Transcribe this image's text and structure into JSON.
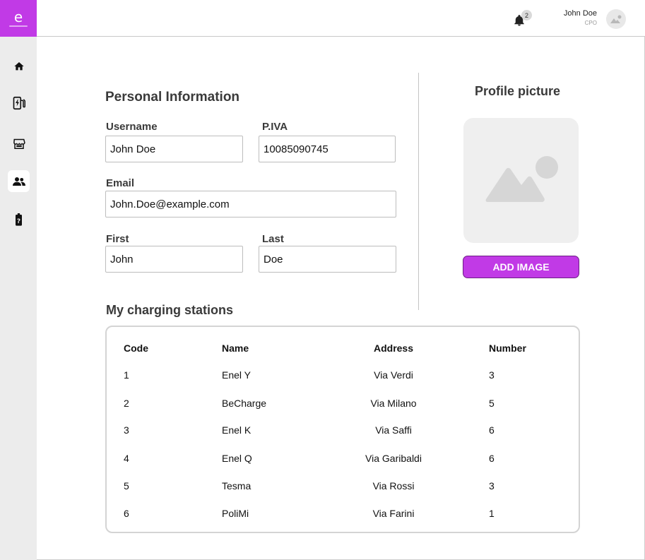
{
  "app": {
    "logo_glyph": "e",
    "brand_color": "#c13ae6"
  },
  "header": {
    "notification_count": "2",
    "user_name": "John Doe",
    "user_role": "CPO",
    "icons": [
      "bell-icon",
      "avatar-image-icon"
    ]
  },
  "sidebar": {
    "items": [
      {
        "name": "home",
        "icon": "home-icon",
        "active": false
      },
      {
        "name": "charging-station",
        "icon": "ev-charger-icon",
        "active": false
      },
      {
        "name": "store",
        "icon": "store-icon",
        "active": false
      },
      {
        "name": "users",
        "icon": "users-icon",
        "active": true
      },
      {
        "name": "battery-help",
        "icon": "battery-question-icon",
        "active": false
      }
    ]
  },
  "personal": {
    "title": "Personal Information",
    "username_label": "Username",
    "username_value": "John Doe",
    "piva_label": "P.IVA",
    "piva_value": "10085090745",
    "email_label": "Email",
    "email_value": "John.Doe@example.com",
    "first_label": "First",
    "first_value": "John",
    "last_label": "Last",
    "last_value": "Doe"
  },
  "profile": {
    "title": "Profile picture",
    "placeholder_icon": "image-placeholder-icon",
    "add_button": "ADD IMAGE"
  },
  "stations": {
    "title": "My charging stations",
    "columns": [
      "Code",
      "Name",
      "Address",
      "Number"
    ],
    "rows": [
      {
        "code": "1",
        "name": "Enel Y",
        "address": "Via Verdi",
        "number": "3"
      },
      {
        "code": "2",
        "name": "BeCharge",
        "address": "Via Milano",
        "number": "5"
      },
      {
        "code": "3",
        "name": "Enel K",
        "address": "Via Saffi",
        "number": "6"
      },
      {
        "code": "4",
        "name": "Enel Q",
        "address": "Via Garibaldi",
        "number": "6"
      },
      {
        "code": "5",
        "name": "Tesma",
        "address": "Via Rossi",
        "number": "3"
      },
      {
        "code": "6",
        "name": "PoliMi",
        "address": "Via Farini",
        "number": "1"
      }
    ]
  }
}
